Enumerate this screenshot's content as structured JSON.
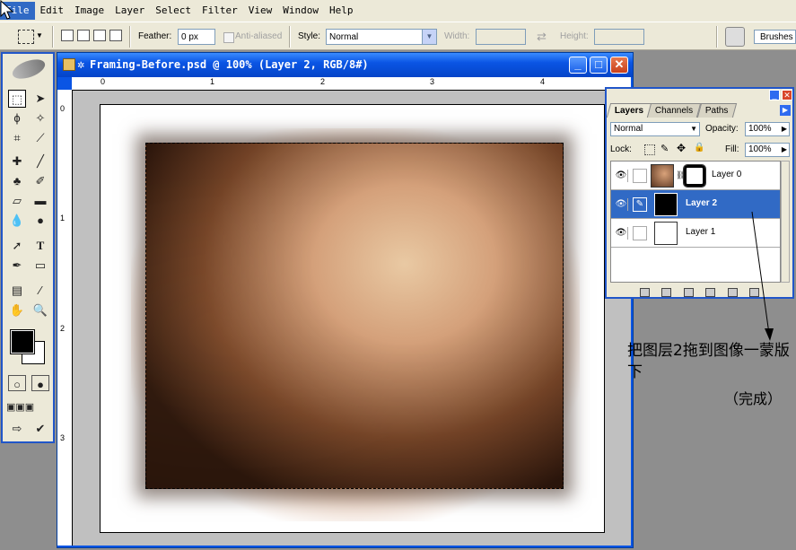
{
  "menubar": {
    "items": [
      "File",
      "Edit",
      "Image",
      "Layer",
      "Select",
      "Filter",
      "View",
      "Window",
      "Help"
    ]
  },
  "options": {
    "feather_label": "Feather:",
    "feather_value": "0 px",
    "antialiased": "Anti-aliased",
    "style_label": "Style:",
    "style_value": "Normal",
    "width_label": "Width:",
    "height_label": "Height:",
    "brushes_label": "Brushes"
  },
  "document": {
    "title": "Framing-Before.psd @ 100% (Layer 2, RGB/8#)",
    "ruler_top": [
      "0",
      "1",
      "2",
      "3",
      "4"
    ],
    "ruler_left": [
      "0",
      "1",
      "2",
      "3"
    ]
  },
  "layers_panel": {
    "tabs": [
      "Layers",
      "Channels",
      "Paths"
    ],
    "blend_mode": "Normal",
    "opacity_label": "Opacity:",
    "opacity_value": "100%",
    "lock_label": "Lock:",
    "fill_label": "Fill:",
    "fill_value": "100%",
    "layers": [
      {
        "name": "Layer 0",
        "selected": false
      },
      {
        "name": "Layer 2",
        "selected": true
      },
      {
        "name": "Layer 1",
        "selected": false
      }
    ]
  },
  "annotation": {
    "line1": "把图层2拖到图像一蒙版下",
    "line2": "（完成）"
  },
  "icons": [
    "pointer-cursor-icon",
    "marquee-icon",
    "move-icon",
    "lasso-icon",
    "magic-wand-icon",
    "crop-icon",
    "slice-icon",
    "healing-icon",
    "brush-icon",
    "stamp-icon",
    "history-brush-icon",
    "eraser-icon",
    "gradient-icon",
    "blur-icon",
    "dodge-icon",
    "path-select-icon",
    "type-icon",
    "pen-icon",
    "shape-icon",
    "notes-icon",
    "eyedropper-icon",
    "hand-icon",
    "zoom-icon",
    "eye-icon",
    "link-icon",
    "brush-small-icon"
  ]
}
